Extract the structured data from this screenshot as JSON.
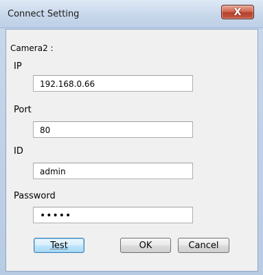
{
  "window": {
    "title": "Connect Setting",
    "close_symbol": "X"
  },
  "form": {
    "camera_label": "Camera2 :",
    "ip_label": "IP",
    "ip_value": "192.168.0.66",
    "port_label": "Port",
    "port_value": "80",
    "id_label": "ID",
    "id_value": "admin",
    "password_label": "Password",
    "password_masked": "•••••"
  },
  "buttons": {
    "test": "Test",
    "ok": "OK",
    "cancel": "Cancel"
  }
}
